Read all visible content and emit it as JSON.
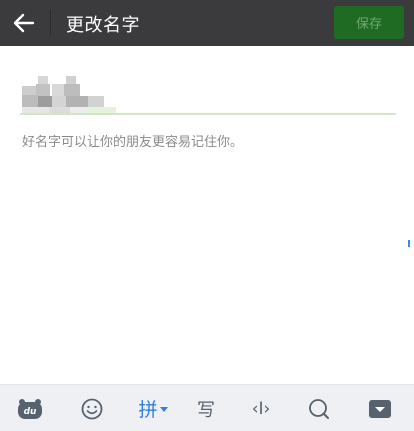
{
  "header": {
    "title": "更改名字",
    "save_label": "保存"
  },
  "form": {
    "hint": "好名字可以让你的朋友更容易记住你。"
  },
  "keyboard_toolbar": {
    "items": [
      {
        "icon": "du-logo-icon"
      },
      {
        "icon": "emoji-icon"
      },
      {
        "label": "拼",
        "icon": "pinyin-icon"
      },
      {
        "label": "写",
        "icon": "handwriting-icon"
      },
      {
        "label": "‹I›",
        "icon": "cursor-move-icon"
      },
      {
        "icon": "search-icon"
      },
      {
        "icon": "keyboard-hide-icon"
      }
    ]
  },
  "colors": {
    "header_bg": "#3b3b3d",
    "save_bg": "#1f6b23",
    "save_text": "#6fa873",
    "underline": "#cfe8c4",
    "accent_blue": "#2f7ee0"
  }
}
